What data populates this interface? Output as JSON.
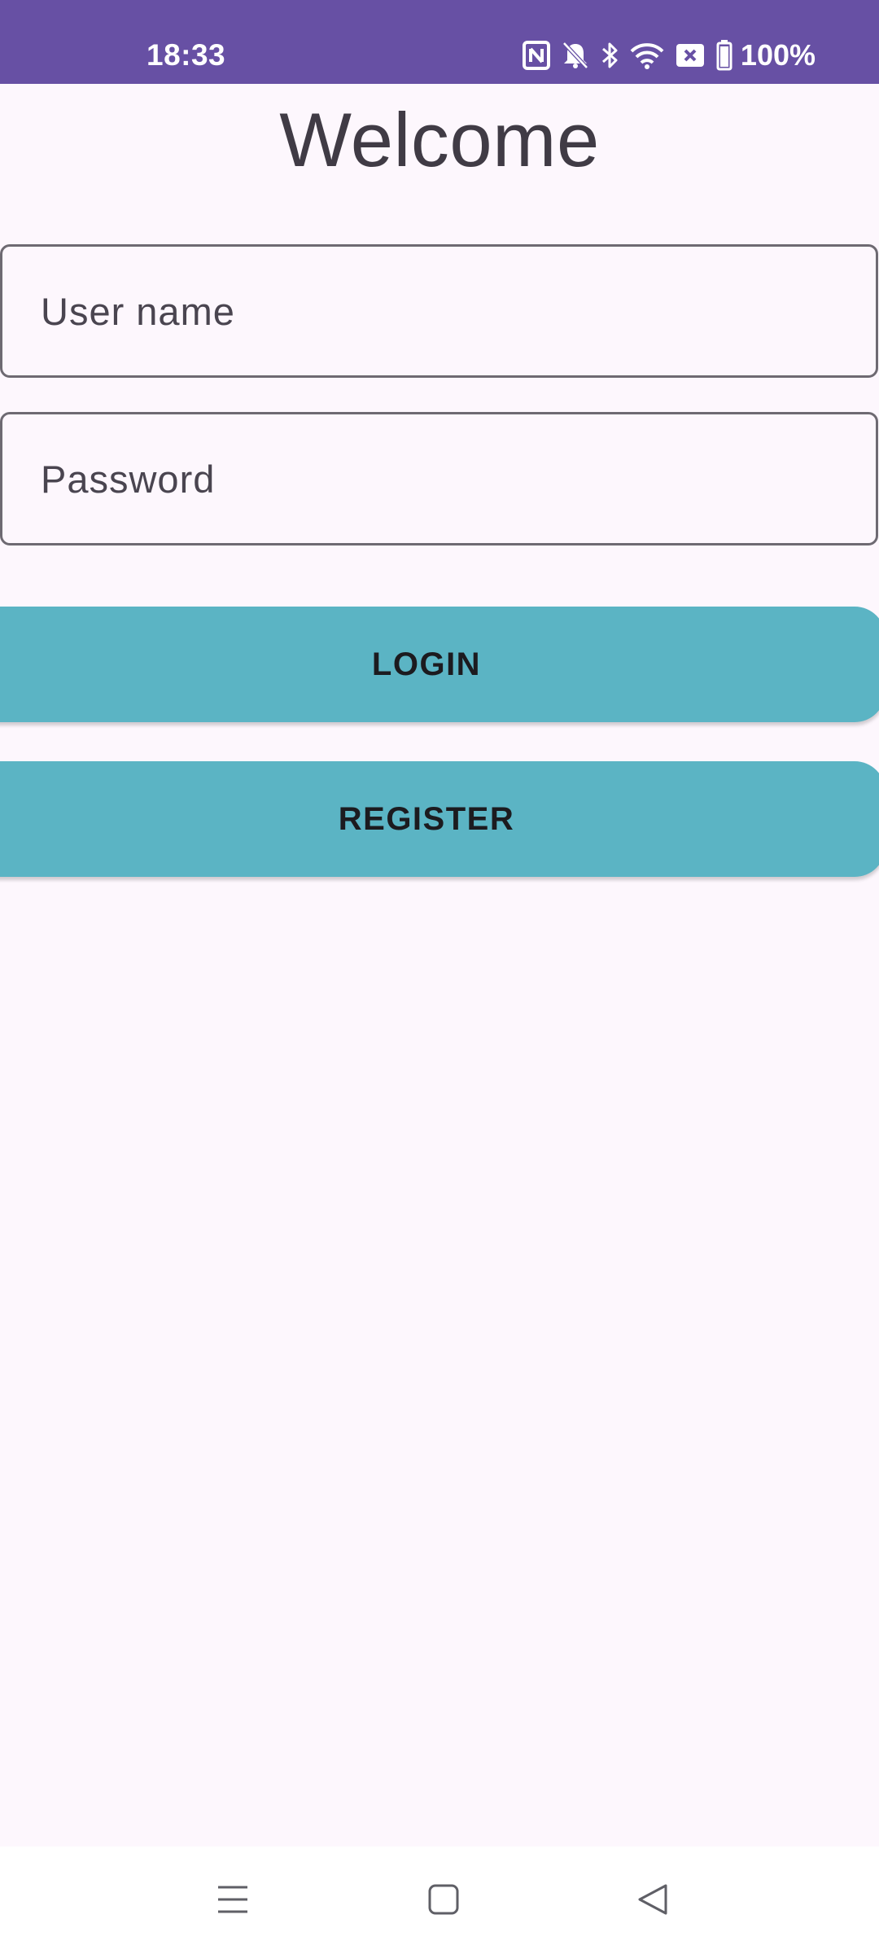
{
  "status_bar": {
    "time": "18:33",
    "battery": "100%",
    "icons": [
      "nfc-icon",
      "notifications-off-icon",
      "bluetooth-icon",
      "wifi-icon",
      "no-sim-icon",
      "battery-icon"
    ]
  },
  "login": {
    "title": "Welcome",
    "username_placeholder": "User name",
    "password_placeholder": "Password",
    "login_label": "LOGIN",
    "register_label": "REGISTER"
  },
  "nav_bar": {
    "icons": [
      "recents-icon",
      "home-icon",
      "back-icon"
    ]
  },
  "colors": {
    "status_bar": "#6750a4",
    "background": "#fdf7fd",
    "button": "#5bb4c4"
  }
}
